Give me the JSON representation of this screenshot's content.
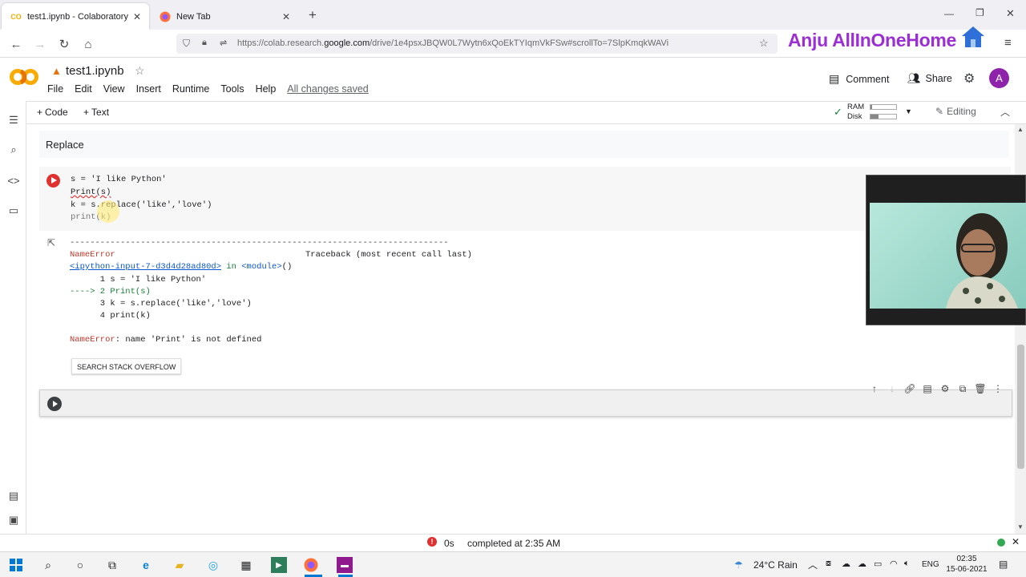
{
  "browser": {
    "tabs": [
      {
        "title": "test1.ipynb - Colaboratory",
        "favicon": "CO",
        "active": true
      },
      {
        "title": "New Tab",
        "favicon": "firefox",
        "active": false
      }
    ],
    "new_tab_symbol": "+",
    "url_prefix": "https://colab.research.",
    "url_domain": "google.com",
    "url_rest": "/drive/1e4psxJBQW0L7Wytn6xQoEkTYIqmVkFSw#scrollTo=7SlpKmqkWAVi",
    "channel_brand": "Anju AllInOneHome"
  },
  "colab": {
    "notebook_title": "test1.ipynb",
    "menu": [
      "File",
      "Edit",
      "View",
      "Insert",
      "Runtime",
      "Tools",
      "Help"
    ],
    "save_status": "All changes saved",
    "comment_label": "Comment",
    "share_label": "Share",
    "avatar_letter": "A",
    "add_code_label": "Code",
    "add_text_label": "Text",
    "ram_label": "RAM",
    "disk_label": "Disk",
    "editing_label": "Editing"
  },
  "cells": {
    "text_cell": "Replace",
    "code_lines": [
      "s = 'I like Python'",
      "Print(s)",
      "k = s.replace('like','love')",
      "print(k)"
    ],
    "output": {
      "dashes": "---------------------------------------------------------------------------",
      "error_name": "NameError",
      "traceback_label": "Traceback (most recent call last)",
      "input_ref": "<ipython-input-7-d3d4d28ad80d>",
      "in_text": " in ",
      "module_ref": "<module>",
      "module_suffix": "()",
      "tb_lines": [
        "      1 s = 'I like Python'",
        "----> 2 Print(s)",
        "      3 k = s.replace('like','love')",
        "      4 print(k)"
      ],
      "final_error_name": "NameError",
      "final_error_msg": ": name 'Print' is not defined",
      "search_button": "SEARCH STACK OVERFLOW"
    }
  },
  "status": {
    "time_taken": "0s",
    "completed": "completed at 2:35 AM"
  },
  "taskbar": {
    "weather": "24°C  Rain",
    "lang": "ENG",
    "time": "02:35",
    "date": "15-06-2021"
  },
  "colors": {
    "accent": "#f9ab00",
    "error_red": "#e03131",
    "link_blue": "#0b57d0",
    "brand_purple": "#9b2fd4"
  }
}
